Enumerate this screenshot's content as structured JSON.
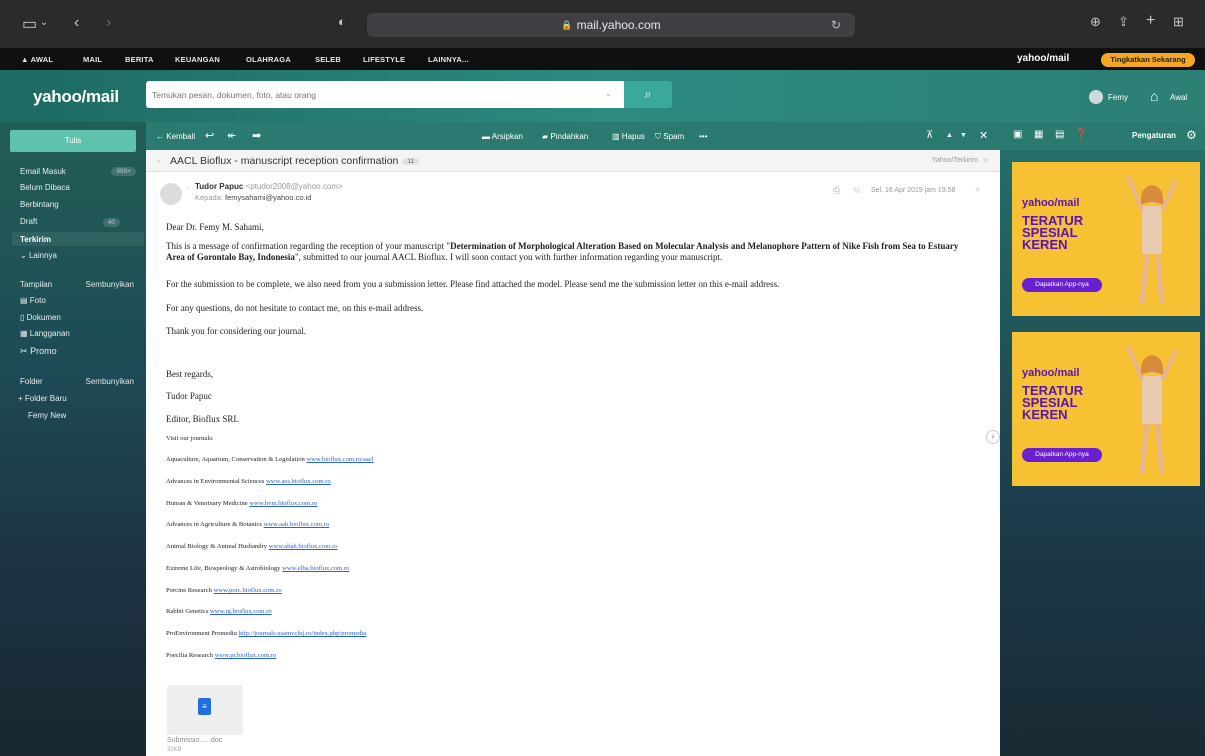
{
  "browser": {
    "url": "mail.yahoo.com"
  },
  "nav": {
    "items": [
      "AWAL",
      "MAIL",
      "BERITA",
      "KEUANGAN",
      "OLAHRAGA",
      "SELEB",
      "LIFESTYLE",
      "LAINNYA..."
    ],
    "brand": "yahoo/mail",
    "upgrade": "Tingkatkan Sekarang"
  },
  "header": {
    "logo": "yahoo/mail",
    "search_placeholder": "Temukan pesan, dokumen, foto, atau orang",
    "user_name": "Femy",
    "home_label": "Awal"
  },
  "sidebar": {
    "compose": "Tulis",
    "inbox": "Email Masuk",
    "inbox_count": "999+",
    "unread": "Belum Dibaca",
    "starred": "Berbintang",
    "drafts": "Draft",
    "drafts_count": "40",
    "sent": "Terkirim",
    "more": "Lainnya",
    "views": "Tampilan",
    "views_hide": "Sembunyikan",
    "photos": "Foto",
    "documents": "Dokumen",
    "subscriptions": "Langganan",
    "promo": "Promo",
    "folders": "Folder",
    "folders_hide": "Sembunyikan",
    "new_folder": "+ Folder Baru",
    "custom_folder": "Femy New"
  },
  "toolbar": {
    "back": "Kembali",
    "archive": "Arsipkan",
    "move": "Pindahkan",
    "delete": "Hapus",
    "spam": "Spam",
    "more": "•••"
  },
  "right_toolbar": {
    "settings": "Pengaturan"
  },
  "email": {
    "subject": "AACL Bioflux - manuscript reception confirmation",
    "thread_count": "11",
    "folder": "Yahoo/Terkirim",
    "sender_name": "Tudor Papuc",
    "sender_email": "<ptudor2008@yahoo.com>",
    "to_label": "Kepada:",
    "to": "femysahami@yahoo.co.id",
    "date": "Sel, 16 Apr 2019 jam 19.58",
    "greeting": "Dear Dr. Femy M. Sahami,",
    "p1_a": "This is a message of confirmation regarding the reception of your manuscript \"",
    "p1_b": "Determination of Morphological Alteration Based on Molecular Analysis and Melanophore Pattern of Nike Fish from Sea to Estuary Area of Gorontalo Bay, Indonesia",
    "p1_c": "\", submitted to our journal AACL Bioflux. I will soon contact you with further information regarding your manuscript.",
    "p2": "For the submission to be complete, we also need from you a submission letter. Please find attached the model. Please send me the submission letter on this e-mail address.",
    "p3": "For any questions, do not hesitate to contact me, on this e-mail address.",
    "p4": "Thank you for considering our journal.",
    "regards": "Best regards,",
    "sig_name": "Tudor Papuc",
    "sig_title": "Editor, Bioflux SRL",
    "visit": "Visit our journals:",
    "journals": [
      {
        "name": "Aquaculture, Aquarium, Conservation & Legislation",
        "url": "www.bioflux.com.ro/aacl"
      },
      {
        "name": "Advances in Environmental Sciences",
        "url": "www.aes.bioflux.com.ro"
      },
      {
        "name": "Human & Veterinary Medicine",
        "url": "www.hvm.bioflux.com.ro"
      },
      {
        "name": "Advances in Agriculture & Botanics",
        "url": "www.aab.bioflux.com.ro"
      },
      {
        "name": "Animal Biology & Animal Husbandry",
        "url": "www.abah.bioflux.com.ro"
      },
      {
        "name": "Extreme Life, Biospeology & Astrobiology",
        "url": "www.elba.bioflux.com.ro"
      },
      {
        "name": "Porcine Research",
        "url": "www.porc.bioflux.com.ro"
      },
      {
        "name": "Rabbit Genetics",
        "url": "www.rg.bioflux.com.ro"
      },
      {
        "name": "ProEnvironment Promediu",
        "url": "http://journals.usamvcluj.ro/index.php/promediu"
      },
      {
        "name": "Poecilia Research",
        "url": "www.pr.bioflux.com.ro"
      }
    ],
    "attachment_name": "Submissio.... .doc",
    "attachment_size": "32KB"
  },
  "ads": [
    {
      "brand": "yahoo/mail",
      "title": "TERATUR SPESIAL KEREN",
      "cta": "Dapatkan App-nya"
    },
    {
      "brand": "yahoo/mail",
      "title": "TERATUR SPESIAL KEREN",
      "cta": "Dapatkan App-nya"
    }
  ]
}
